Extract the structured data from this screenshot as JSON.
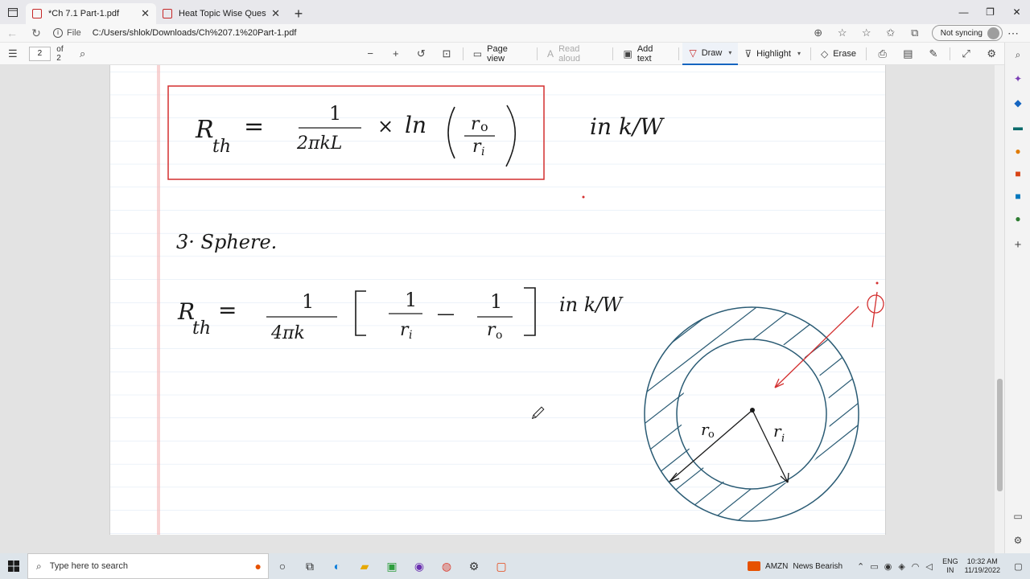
{
  "tabs": [
    {
      "label": "*Ch 7.1 Part-1.pdf",
      "active": true
    },
    {
      "label": "Heat Topic Wise Questions.pdf",
      "active": false
    }
  ],
  "address": {
    "file_label": "File",
    "url": "C:/Users/shlok/Downloads/Ch%207.1%20Part-1.pdf",
    "sync_label": "Not syncing"
  },
  "pdf_toolbar": {
    "page_number": "2",
    "page_total": "of 2",
    "page_view": "Page view",
    "read_aloud": "Read aloud",
    "add_text": "Add text",
    "draw": "Draw",
    "highlight": "Highlight",
    "erase": "Erase"
  },
  "document": {
    "eq1": {
      "lhs_r": "R",
      "lhs_sub": "th",
      "equals": "=",
      "numerator": "1",
      "denominator": "2πkL",
      "times": "×",
      "ln": "ln",
      "ratio_num": "r",
      "ratio_num_sub": "o",
      "ratio_den": "r",
      "ratio_den_sub": "i",
      "units": "in  k/W"
    },
    "section_heading": "3·  Sphere.",
    "eq2": {
      "lhs_r": "R",
      "lhs_sub": "th",
      "equals": "=",
      "numerator": "1",
      "denominator": "4πk",
      "term1_num": "1",
      "term1_den": "r",
      "term1_den_sub": "i",
      "minus": "—",
      "term2_num": "1",
      "term2_den": "r",
      "term2_den_sub": "o",
      "units": "in  k/W"
    },
    "diagram": {
      "outer_radius_label": "r",
      "outer_radius_sub": "o",
      "inner_radius_label": "r",
      "inner_radius_sub": "i"
    },
    "accent_color": "#d32f2f",
    "ink_color": "#1a1a1a",
    "circle_color": "#2a5b74"
  },
  "taskbar": {
    "search_placeholder": "Type here to search",
    "news_ticker": "AMZN",
    "news_text": "News Bearish",
    "lang_line1": "ENG",
    "lang_line2": "IN",
    "time": "10:32 AM",
    "date": "11/19/2022"
  }
}
